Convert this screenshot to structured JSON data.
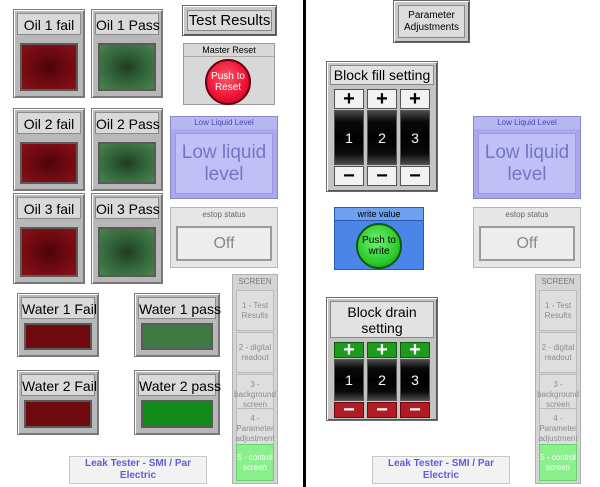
{
  "left": {
    "oil": [
      {
        "fail": "Oil 1 fail",
        "pass": "Oil 1 Pass"
      },
      {
        "fail": "Oil 2 fail",
        "pass": "Oil 2 Pass"
      },
      {
        "fail": "Oil 3 fail",
        "pass": "Oil 3 Pass"
      }
    ],
    "water": [
      {
        "fail": "Water 1 Fail",
        "pass": "Water 1 pass"
      },
      {
        "fail": "Water 2 Fail",
        "pass": "Water 2 pass"
      }
    ],
    "title": "Test Results",
    "master_reset": {
      "header": "Master Reset",
      "button": "Push to Reset"
    },
    "low_liquid": {
      "header": "Low Liquid Level",
      "text": "Low liquid level"
    },
    "estop": {
      "header": "estop status",
      "value": "Off"
    }
  },
  "right": {
    "title": "Parameter Adjustments",
    "block_fill": {
      "title": "Block fill setting",
      "digits": [
        "1",
        "2",
        "3"
      ]
    },
    "write_value": {
      "header": "write value",
      "button": "Push to write"
    },
    "block_drain": {
      "title": "Block drain setting",
      "digits": [
        "1",
        "2",
        "3"
      ]
    },
    "low_liquid": {
      "header": "Low Liquid Level",
      "text": "Low liquid level"
    },
    "estop": {
      "header": "estop status",
      "value": "Off"
    }
  },
  "screen_menu": {
    "header": "SCREEN",
    "items": [
      "1 - Test Results",
      "2 - digital readout",
      "3 - background screen",
      "4 - Parameter adjustment",
      "5 - control screen"
    ],
    "active_index": 4
  },
  "footer": "Leak Tester - SMI / Par Electric",
  "symbols": {
    "plus": "+",
    "minus": "−"
  },
  "colors": {
    "fail": "#6c0910",
    "pass": "#33653a",
    "active_screen": "#8bf08b",
    "footer_text": "#5e5edc"
  }
}
